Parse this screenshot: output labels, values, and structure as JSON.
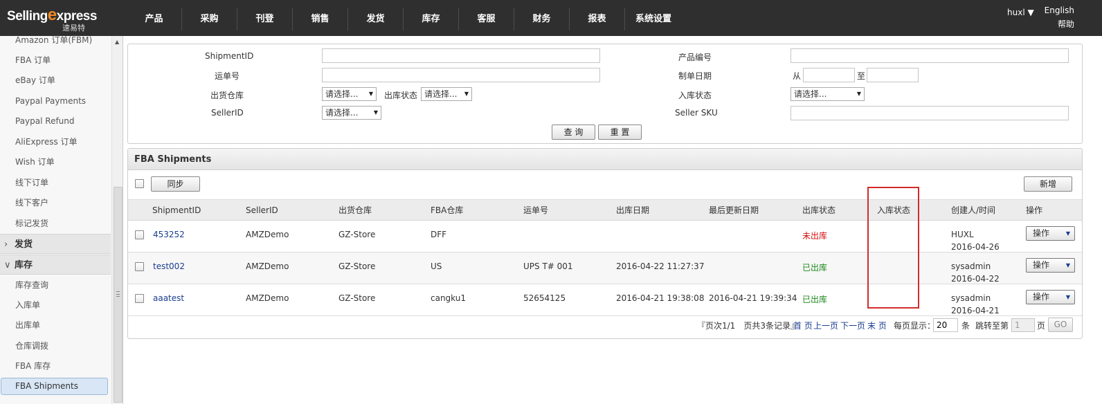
{
  "header": {
    "logo_text_a": "Selling",
    "logo_text_e": "e",
    "logo_text_b": "xpress",
    "logo_sub": "速易特",
    "nav": [
      "产品",
      "采购",
      "刊登",
      "销售",
      "发货",
      "库存",
      "客服",
      "财务",
      "报表",
      "系统设置"
    ],
    "user": "huxl ▼",
    "lang": "English",
    "help": "帮助"
  },
  "sidebar": {
    "items_top": [
      "Amazon 订单(FBM)",
      "FBA 订单",
      "eBay 订单",
      "Paypal Payments",
      "Paypal Refund",
      "AliExpress 订单",
      "Wish 订单",
      "线下订单",
      "线下客户",
      "标记发货"
    ],
    "group_shipping": "发货",
    "group_stock": "库存",
    "items_stock": [
      "库存查询",
      "入库单",
      "出库单",
      "仓库调拨",
      "FBA 库存"
    ],
    "active_item": "FBA Shipments"
  },
  "search": {
    "shipment_id_label": "ShipmentID",
    "shipment_id_value": "",
    "product_code_label": "产品编号",
    "product_code_value": "",
    "waybill_label": "运单号",
    "waybill_value": "",
    "create_date_label": "制单日期",
    "date_from_label": "从",
    "date_from_value": "",
    "date_to_label": "至",
    "date_to_value": "",
    "warehouse_label": "出货仓库",
    "warehouse_value": "请选择...",
    "out_status_label": "出库状态",
    "out_status_value": "请选择...",
    "in_status_label": "入库状态",
    "in_status_value": "请选择...",
    "seller_id_label": "SellerID",
    "seller_id_value": "请选择...",
    "seller_sku_label": "Seller SKU",
    "seller_sku_value": "",
    "query_button": "查 询",
    "reset_button": "重 置"
  },
  "grid": {
    "title": "FBA Shipments",
    "sync_button": "同步",
    "add_button": "新增",
    "columns": [
      "ShipmentID",
      "SellerID",
      "出货仓库",
      "FBA仓库",
      "运单号",
      "出库日期",
      "最后更新日期",
      "出库状态",
      "入库状态",
      "创建人/时间",
      "操作"
    ],
    "rows": [
      {
        "shipment_id": "453252",
        "seller_id": "AMZDemo",
        "warehouse": "GZ-Store",
        "fba_warehouse": "DFF",
        "waybill": "",
        "out_date": "",
        "updated": "",
        "out_status": "未出库",
        "in_status": "",
        "creator": "HUXL",
        "created": "2016-04-26",
        "action": "操作"
      },
      {
        "shipment_id": "test002",
        "seller_id": "AMZDemo",
        "warehouse": "GZ-Store",
        "fba_warehouse": "US",
        "waybill": "UPS T# 001",
        "out_date": "2016-04-22 11:27:37",
        "updated": "",
        "out_status": "已出库",
        "in_status": "",
        "creator": "sysadmin",
        "created": "2016-04-22",
        "action": "操作"
      },
      {
        "shipment_id": "aaatest",
        "seller_id": "AMZDemo",
        "warehouse": "GZ-Store",
        "fba_warehouse": "cangku1",
        "waybill": "52654125",
        "out_date": "2016-04-21 19:38:08",
        "updated": "2016-04-21 19:39:34",
        "out_status": "已出库",
        "in_status": "",
        "creator": "sysadmin",
        "created": "2016-04-21",
        "action": "操作"
      }
    ],
    "pager": {
      "summary": "『页次1/1　页共3条记录』",
      "first": "首 页",
      "prev": "上一页",
      "next": "下一页",
      "last": "末 页",
      "per_page_label": "每页显示：",
      "per_page_value": "20",
      "per_page_unit": "条",
      "jump_label": "跳转至第",
      "jump_value": "1",
      "page_unit": "页",
      "go": "GO"
    }
  },
  "colors": {
    "topbar": "#2f2f2f",
    "logo_accent": "#f08a24",
    "link": "#1a3d8f",
    "status_pending": "#d01010",
    "status_done": "#1c8a1c",
    "highlight": "#d12b2b"
  }
}
